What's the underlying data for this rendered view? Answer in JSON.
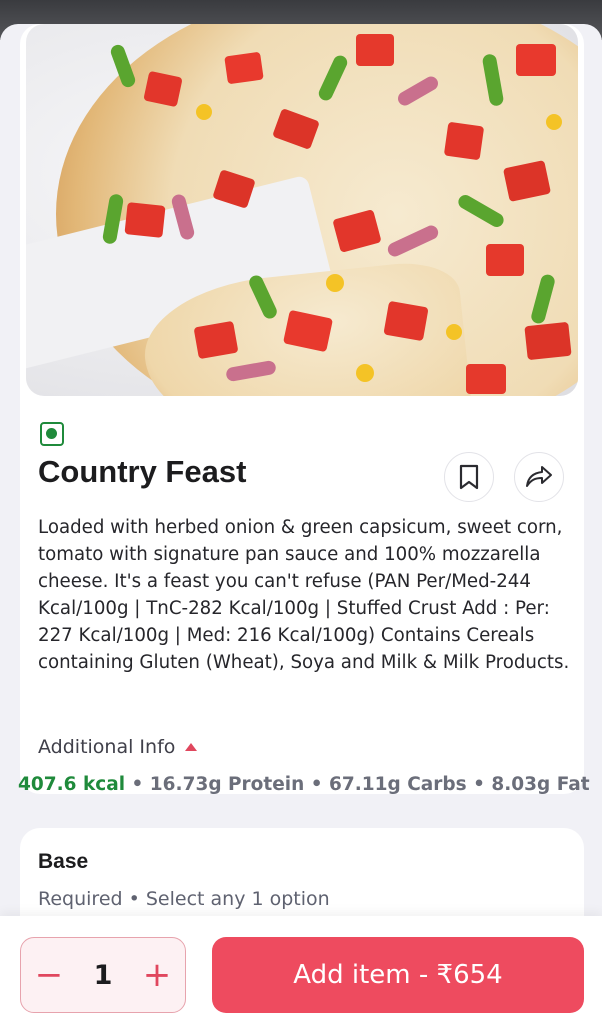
{
  "item": {
    "veg_icon": "veg-indicator-icon",
    "name": "Country Feast",
    "description": "Loaded with herbed onion & green capsicum, sweet corn, tomato with signature pan sauce and 100% mozzarella cheese. It's a feast you can't refuse (PAN Per/Med-244 Kcal/100g | TnC-282 Kcal/100g | Stuffed Crust Add : Per: 227 Kcal/100g | Med: 216 Kcal/100g) Contains Cereals containing Gluten (Wheat), Soya and Milk & Milk Products.",
    "additional_info_label": "Additional Info",
    "nutrition": {
      "kcal": "407.6 kcal",
      "protein": "16.73g Protein",
      "carbs": "67.11g Carbs",
      "fat": "8.03g Fat",
      "separator": "•"
    },
    "actions": {
      "bookmark_icon": "bookmark-icon",
      "share_icon": "share-icon"
    }
  },
  "base_section": {
    "title": "Base",
    "subtitle": "Required • Select any 1 option"
  },
  "footer": {
    "quantity": "1",
    "minus": "−",
    "plus": "+",
    "add_label": "Add item - ₹654"
  },
  "colors": {
    "accent": "#ee4b5f",
    "veg_green": "#1f8a3b",
    "kcal_green": "#1f8a3b"
  }
}
